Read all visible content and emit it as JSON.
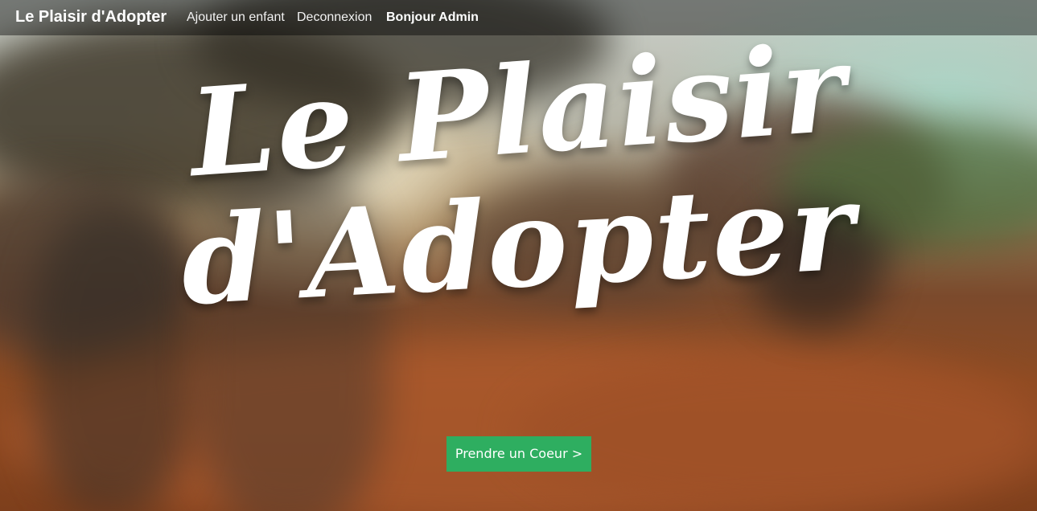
{
  "navbar": {
    "brand": "Le Plaisir d'Adopter",
    "links": [
      {
        "label": "Ajouter un enfant"
      },
      {
        "label": "Deconnexion"
      }
    ],
    "greeting": "Bonjour Admin"
  },
  "hero": {
    "title_line_1": "Le Plaisir",
    "title_line_2": "d'Adopter",
    "cta_label": "Prendre un Coeur >"
  },
  "colors": {
    "navbar_bg": "#2a2a2a",
    "cta_bg": "#2eae60",
    "text": "#ffffff"
  }
}
